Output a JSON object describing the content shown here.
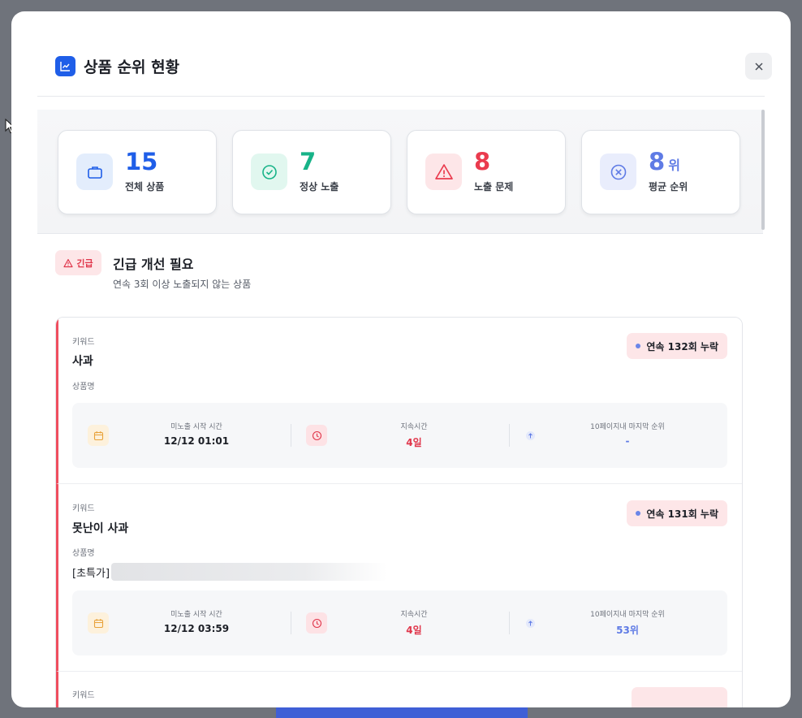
{
  "modal": {
    "title": "상품 순위 현황",
    "title_icon": "chart-line-icon",
    "close_icon": "close-icon"
  },
  "stats": [
    {
      "value": "15",
      "unit": "",
      "label": "전체 상품",
      "icon": "briefcase-icon",
      "color": "#1f5ee8",
      "bg": "#e3edfc"
    },
    {
      "value": "7",
      "unit": "",
      "label": "정상 노출",
      "icon": "check-circle-icon",
      "color": "#17b388",
      "bg": "#e1f7ef"
    },
    {
      "value": "8",
      "unit": "",
      "label": "노출 문제",
      "icon": "warning-triangle-icon",
      "color": "#ea3b4e",
      "bg": "#fde6e8"
    },
    {
      "value": "8",
      "unit": "위",
      "label": "평균 순위",
      "icon": "x-circle-icon",
      "color": "#5f7be5",
      "bg": "#e9edfc"
    }
  ],
  "urgent": {
    "badge": "긴급",
    "title": "긴급 개선 필요",
    "subtitle": "연속 3회 이상 노출되지 않는 상품"
  },
  "labels": {
    "keyword": "키워드",
    "product_name": "상품명",
    "start_time": "미노출 시작 시간",
    "duration": "지속시간",
    "last_rank": "10페이지내 마지막 순위"
  },
  "items": [
    {
      "keyword": "사과",
      "product": "",
      "missed": "연속 132회 누락",
      "start": "12/12 01:01",
      "duration": "4일",
      "rank": "-"
    },
    {
      "keyword": "못난이 사과",
      "product": "[초특가]",
      "missed": "연속 131회 누락",
      "start": "12/12 03:59",
      "duration": "4일",
      "rank": "53위"
    },
    {
      "keyword": "키워드",
      "product": "",
      "missed": "",
      "start": "",
      "duration": "",
      "rank": ""
    }
  ],
  "colors": {
    "accent": "#1f5ee8",
    "danger": "#e0364b",
    "rank": "#5f7be5"
  }
}
